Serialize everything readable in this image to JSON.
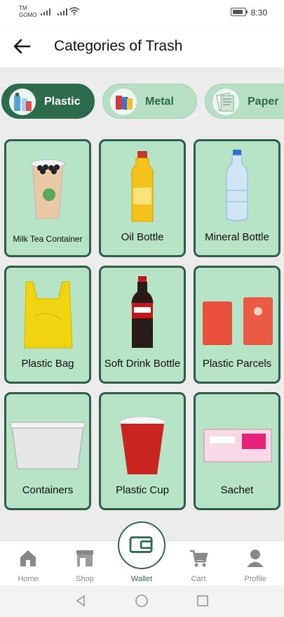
{
  "status": {
    "carrier_line1": "TM",
    "carrier_line2": "GOMO",
    "time": "8:30"
  },
  "header": {
    "title": "Categories of Trash"
  },
  "chips": [
    {
      "label": "Plastic",
      "active": true
    },
    {
      "label": "Metal",
      "active": false
    },
    {
      "label": "Paper",
      "active": false
    }
  ],
  "items": [
    {
      "label": "Milk Tea Container"
    },
    {
      "label": "Oil Bottle"
    },
    {
      "label": "Mineral Bottle"
    },
    {
      "label": "Plastic Bag"
    },
    {
      "label": "Soft Drink Bottle"
    },
    {
      "label": "Plastic Parcels"
    },
    {
      "label": "Containers"
    },
    {
      "label": "Plastic Cup"
    },
    {
      "label": "Sachet"
    }
  ],
  "nav": [
    {
      "label": "Home",
      "icon": "home-icon"
    },
    {
      "label": "Shop",
      "icon": "shop-icon"
    },
    {
      "label": "Wallet",
      "icon": "wallet-icon"
    },
    {
      "label": "Cart",
      "icon": "cart-icon"
    },
    {
      "label": "Profile",
      "icon": "profile-icon"
    }
  ],
  "colors": {
    "accent": "#2d6b4d",
    "card_bg": "#b7e3c6",
    "card_border": "#2f5d48",
    "content_bg": "#ececec"
  }
}
